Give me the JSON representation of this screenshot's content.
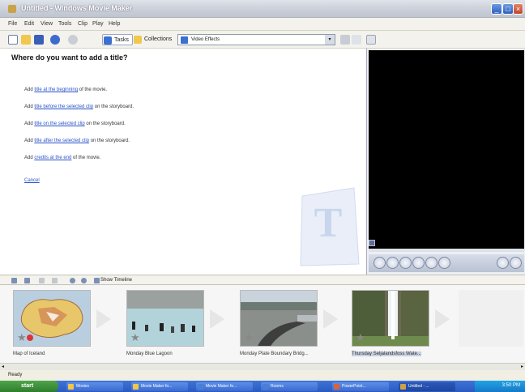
{
  "window": {
    "title": "Untitled - Windows Movie Maker"
  },
  "menu": [
    "File",
    "Edit",
    "View",
    "Tools",
    "Clip",
    "Play",
    "Help"
  ],
  "toolbar": {
    "tasks": "Tasks",
    "collections": "Collections",
    "combo_value": "Video Effects"
  },
  "task_pane": {
    "heading": "Where do you want to add a title?",
    "options": [
      {
        "prefix": "Add ",
        "link": "title at the beginning",
        "suffix": " of the movie."
      },
      {
        "prefix": "Add ",
        "link": "title before the selected clip",
        "suffix": " on the storyboard."
      },
      {
        "prefix": "Add ",
        "link": "title on the selected clip",
        "suffix": " on the storyboard."
      },
      {
        "prefix": "Add ",
        "link": "title after the selected clip",
        "suffix": " on the storyboard."
      },
      {
        "prefix": "Add ",
        "link": "credits at the end",
        "suffix": " of the movie."
      }
    ],
    "cancel": "Cancel"
  },
  "storyboard": {
    "toolbar_label": "Show Timeline",
    "clips": [
      {
        "label": "Map of Iceland"
      },
      {
        "label": "Monday Blue Lagoon"
      },
      {
        "label": "Monday Plate Boundary Bridg..."
      },
      {
        "label": "Thursday Seljalandsfoss Wate..."
      }
    ]
  },
  "status": "Ready",
  "taskbar": {
    "start": "start",
    "tasks": [
      "Movies",
      "Movie Maker fo...",
      "Movie Maker fo...",
      "Rooms",
      "PowerPoint...",
      "Untitled - ..."
    ],
    "clock": "3:50 PM"
  }
}
